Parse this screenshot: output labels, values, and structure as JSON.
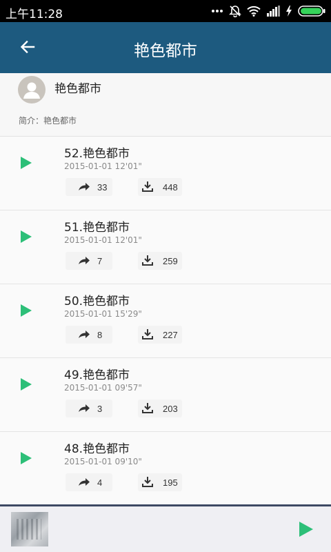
{
  "status_bar": {
    "time": "上午11:28",
    "icons": [
      "more-dots-icon",
      "mute-icon",
      "wifi-icon",
      "signal-icon",
      "charging-icon",
      "battery-icon"
    ]
  },
  "app_bar": {
    "title": "艳色都市",
    "back_icon": "arrow-left-icon"
  },
  "header": {
    "name": "艳色都市",
    "description": "简介：艳色都市"
  },
  "tracks": [
    {
      "title": "52.艳色都市",
      "meta": "2015-01-01  12'01\"",
      "shares": "33",
      "downloads": "448"
    },
    {
      "title": "51.艳色都市",
      "meta": "2015-01-01  12'01\"",
      "shares": "7",
      "downloads": "259"
    },
    {
      "title": "50.艳色都市",
      "meta": "2015-01-01  15'29\"",
      "shares": "8",
      "downloads": "227"
    },
    {
      "title": "49.艳色都市",
      "meta": "2015-01-01  09'57\"",
      "shares": "3",
      "downloads": "203"
    },
    {
      "title": "48.艳色都市",
      "meta": "2015-01-01  09'10\"",
      "shares": "4",
      "downloads": "195"
    }
  ],
  "colors": {
    "app_bar": "#1d5a7f",
    "accent_green": "#2dbf78",
    "player_border": "#3d4963"
  }
}
